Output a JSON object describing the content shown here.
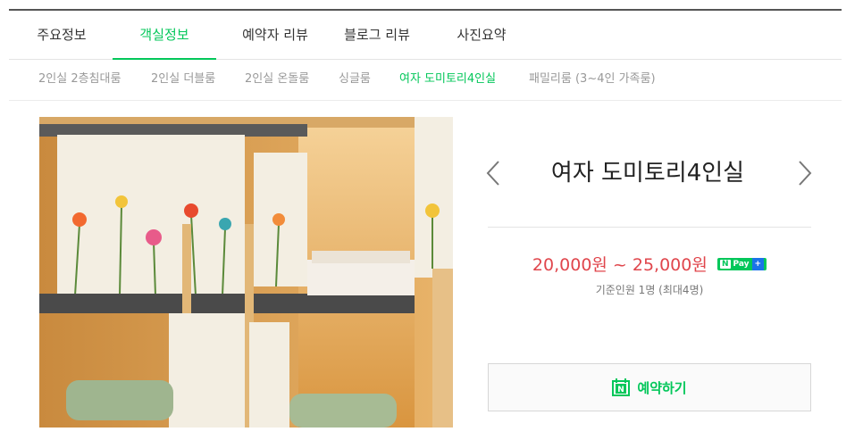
{
  "main_tabs": [
    "주요정보",
    "객실정보",
    "예약자 리뷰",
    "블로그 리뷰",
    "사진요약"
  ],
  "main_active": "객실정보",
  "sub_tabs": [
    "2인실 2층침대룸",
    "2인실 더블룸",
    "2인실 온돌룸",
    "싱글룸",
    "여자 도미토리4인실",
    "패밀리룸 (3~4인 가족룸)"
  ],
  "sub_active": "여자 도미토리4인실",
  "room": {
    "title": "여자 도미토리4인실",
    "price": "20,000원 ~ 25,000원",
    "npay_n": "N",
    "npay_label": "Pay",
    "npay_plus": "+",
    "capacity": "기준인원 1명 (최대4명)"
  },
  "reserve": {
    "icon_letter": "N",
    "label": "예약하기"
  },
  "colors": {
    "accent": "#03c75a",
    "price": "#e0464c"
  },
  "icons": {
    "prev": "chevron-left-icon",
    "next": "chevron-right-icon",
    "reserve": "naver-calendar-icon"
  }
}
